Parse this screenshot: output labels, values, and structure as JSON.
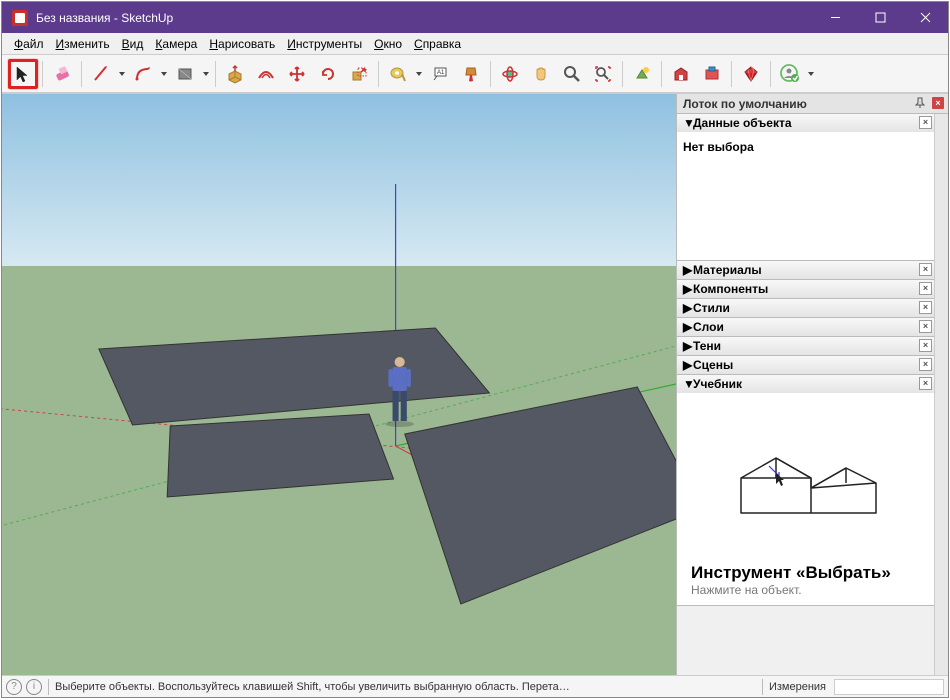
{
  "window": {
    "title": "Без названия - SketchUp"
  },
  "menu": {
    "file": "Файл",
    "edit": "Изменить",
    "view": "Вид",
    "camera": "Камера",
    "draw": "Нарисовать",
    "tools": "Инструменты",
    "window": "Окно",
    "help": "Справка"
  },
  "toolbar": {
    "select": "select",
    "eraser": "eraser",
    "line": "line",
    "arc": "arc",
    "shape": "shape",
    "pushpull": "pushpull",
    "offset": "offset",
    "move": "move",
    "rotate": "rotate",
    "scale": "scale",
    "tape": "tape",
    "text": "text",
    "paint": "paint",
    "orbit": "orbit",
    "pan": "pan",
    "zoom": "zoom",
    "zoomextents": "zoomextents",
    "addloc": "addloc",
    "warehouse": "warehouse",
    "extensions": "extensions",
    "ruby": "ruby",
    "user": "user"
  },
  "tray": {
    "title": "Лоток по умолчанию",
    "entity": {
      "title": "Данные объекта",
      "empty": "Нет выбора"
    },
    "materials": {
      "title": "Материалы"
    },
    "components": {
      "title": "Компоненты"
    },
    "styles": {
      "title": "Стили"
    },
    "layers": {
      "title": "Слои"
    },
    "shadows": {
      "title": "Тени"
    },
    "scenes": {
      "title": "Сцены"
    },
    "instructor": {
      "title": "Учебник",
      "tool_title": "Инструмент «Выбрать»",
      "tool_sub": "Нажмите на объект."
    }
  },
  "statusbar": {
    "hint": "Выберите объекты. Воспользуйтесь клавишей Shift, чтобы увеличить выбранную область. Перета…",
    "measure_label": "Измерения"
  }
}
